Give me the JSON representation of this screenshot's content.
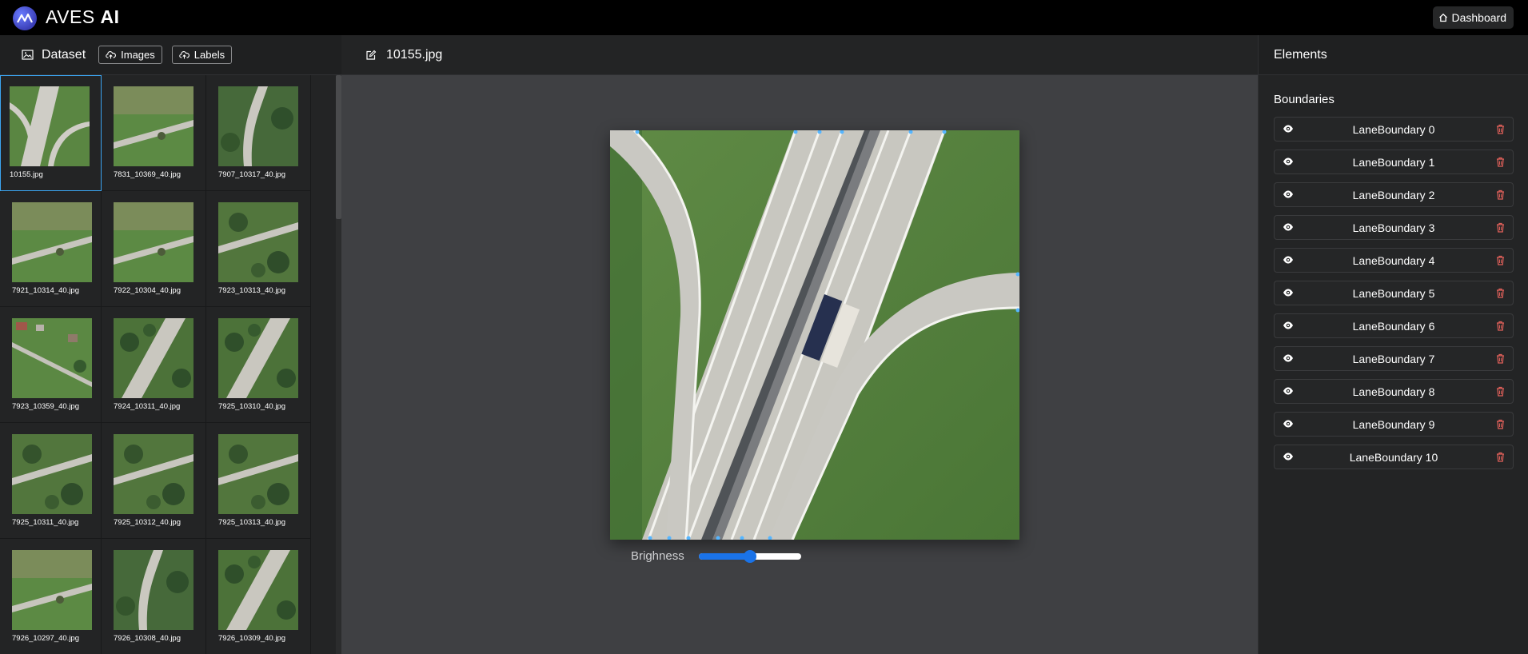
{
  "app": {
    "brand_regular": "AVES ",
    "brand_bold": "AI",
    "dashboard_label": "Dashboard"
  },
  "dataset": {
    "title": "Dataset",
    "images_button": "Images",
    "labels_button": "Labels",
    "selected_index": 0,
    "files": [
      {
        "name": "10155.jpg",
        "icon": "highway-interchange"
      },
      {
        "name": "7831_10369_40.jpg",
        "icon": "road-field"
      },
      {
        "name": "7907_10317_40.jpg",
        "icon": "curved-road-forest"
      },
      {
        "name": "7921_10314_40.jpg",
        "icon": "road-field"
      },
      {
        "name": "7922_10304_40.jpg",
        "icon": "road-field"
      },
      {
        "name": "7923_10313_40.jpg",
        "icon": "road-forest"
      },
      {
        "name": "7923_10359_40.jpg",
        "icon": "village-field"
      },
      {
        "name": "7924_10311_40.jpg",
        "icon": "highway-forest"
      },
      {
        "name": "7925_10310_40.jpg",
        "icon": "highway-forest"
      },
      {
        "name": "7925_10311_40.jpg",
        "icon": "road-forest"
      },
      {
        "name": "7925_10312_40.jpg",
        "icon": "road-forest"
      },
      {
        "name": "7925_10313_40.jpg",
        "icon": "road-forest"
      },
      {
        "name": "7926_10297_40.jpg",
        "icon": "road-field"
      },
      {
        "name": "7926_10308_40.jpg",
        "icon": "curved-road-forest"
      },
      {
        "name": "7926_10309_40.jpg",
        "icon": "highway-forest"
      }
    ]
  },
  "editor": {
    "filename": "10155.jpg",
    "brightness_label": "Brighness",
    "brightness_value": 0.5
  },
  "elements": {
    "title": "Elements",
    "section": "Boundaries",
    "items": [
      "LaneBoundary 0",
      "LaneBoundary 1",
      "LaneBoundary 2",
      "LaneBoundary 3",
      "LaneBoundary 4",
      "LaneBoundary 5",
      "LaneBoundary 6",
      "LaneBoundary 7",
      "LaneBoundary 8",
      "LaneBoundary 9",
      "LaneBoundary 10"
    ]
  },
  "colors": {
    "accent": "#1a73e8",
    "selection": "#3ba4f0",
    "trash": "#e0605a",
    "grass": "#4e7a3c",
    "asphalt": "#c9c8c2"
  }
}
